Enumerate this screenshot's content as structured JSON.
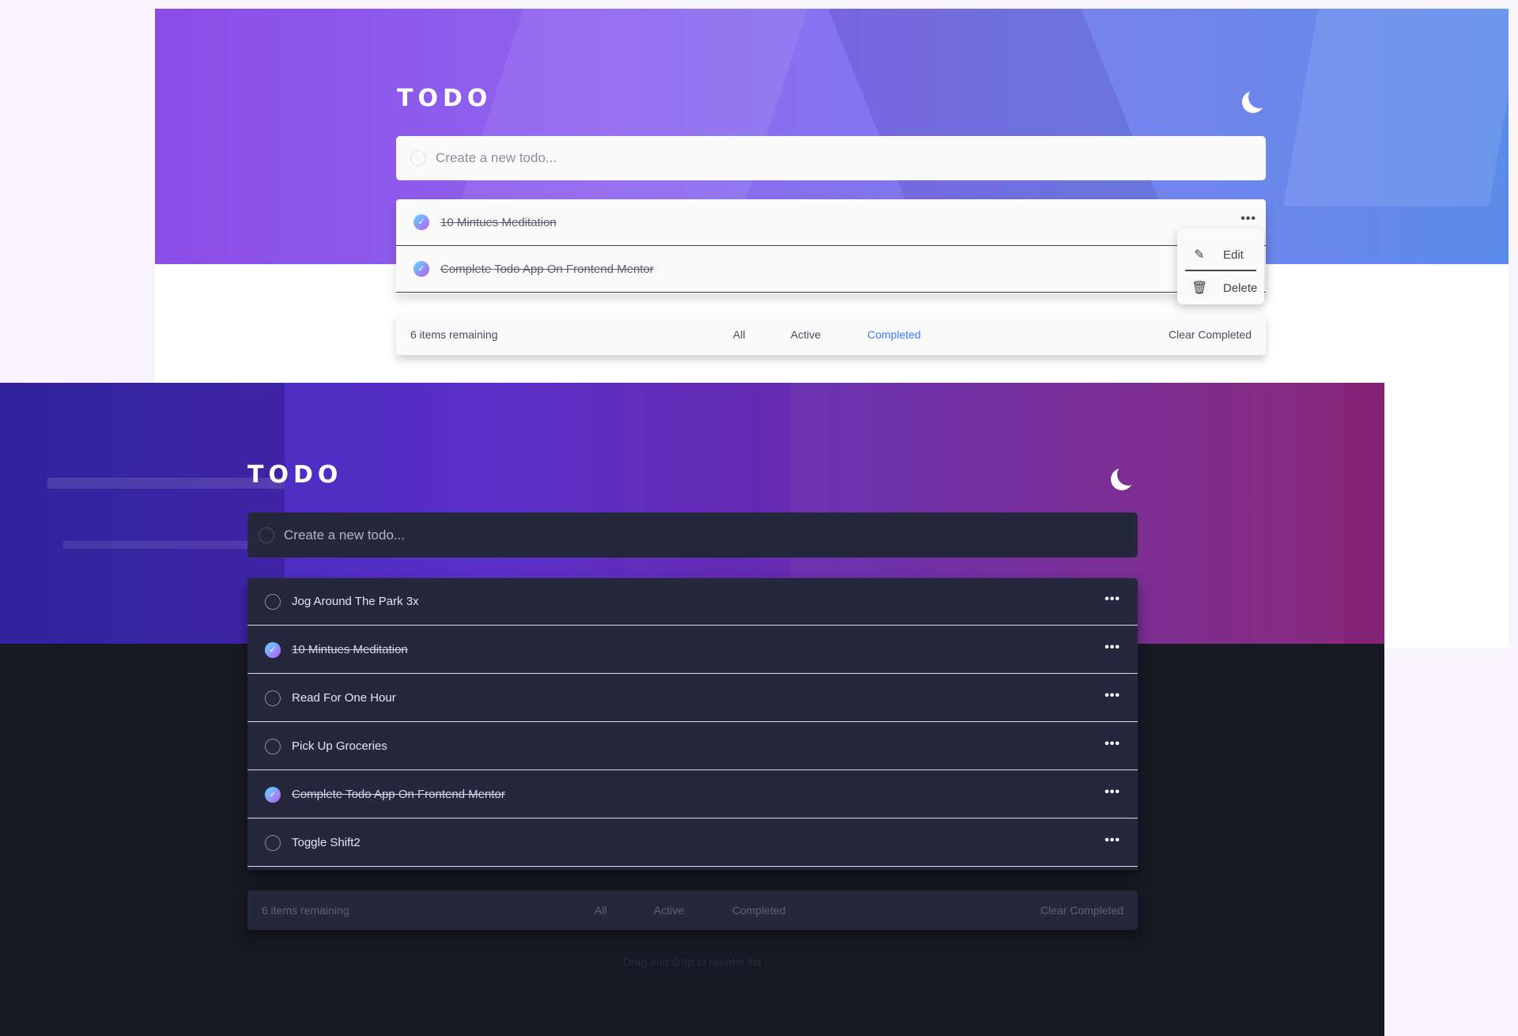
{
  "light": {
    "logo": "TODO",
    "input_placeholder": "Create a new todo...",
    "todos": [
      {
        "text": "10 Mintues Meditation",
        "completed": true
      },
      {
        "text": "Complete Todo App On Frontend Mentor",
        "completed": true
      }
    ],
    "menu": {
      "edit": "Edit",
      "delete": "Delete"
    },
    "footer": {
      "items_left": "6 items remaining",
      "filter_all": "All",
      "filter_active": "Active",
      "filter_completed": "Completed",
      "clear": "Clear Completed",
      "active_filter": "Completed"
    }
  },
  "dark": {
    "logo": "TODO",
    "input_placeholder": "Create a new todo...",
    "todos": [
      {
        "text": "Jog Around The Park 3x",
        "completed": false
      },
      {
        "text": "10 Mintues Meditation",
        "completed": true
      },
      {
        "text": "Read For One Hour",
        "completed": false
      },
      {
        "text": "Pick Up Groceries",
        "completed": false
      },
      {
        "text": "Complete Todo App On Frontend Mentor",
        "completed": true
      },
      {
        "text": "Toggle Shift2",
        "completed": false
      }
    ],
    "footer": {
      "items_left": "6 items remaining",
      "filter_all": "All",
      "filter_active": "Active",
      "filter_completed": "Completed",
      "clear": "Clear Completed"
    },
    "hint": "Drag and drop to reorder list"
  },
  "icons": {
    "theme_toggle": "moon-icon",
    "menu": "more-horizontal-icon",
    "edit": "edit-icon",
    "delete": "trash-icon",
    "check": "check-icon"
  },
  "colors": {
    "accent_blue": "#3a7bfd",
    "check_gradient_start": "#57ddff",
    "check_gradient_end": "#c058f3",
    "dark_bg": "#181824",
    "dark_card": "#25273c"
  }
}
